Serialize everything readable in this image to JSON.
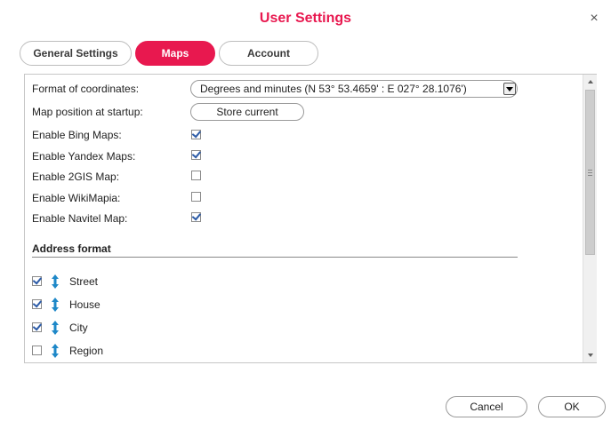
{
  "dialog": {
    "title": "User Settings",
    "close_symbol": "×"
  },
  "tabs": [
    {
      "label": "General Settings",
      "active": false
    },
    {
      "label": "Maps",
      "active": true
    },
    {
      "label": "Account",
      "active": false
    }
  ],
  "maps": {
    "format_label": "Format of coordinates:",
    "format_value": "Degrees and minutes (N 53° 53.4659' : E 027° 28.1076')",
    "startup_label": "Map position at startup:",
    "store_button": "Store current",
    "options": [
      {
        "label": "Enable Bing Maps:",
        "checked": true
      },
      {
        "label": "Enable Yandex Maps:",
        "checked": true
      },
      {
        "label": "Enable 2GIS Map:",
        "checked": false
      },
      {
        "label": "Enable WikiMapia:",
        "checked": false
      },
      {
        "label": "Enable Navitel Map:",
        "checked": true
      }
    ],
    "address_title": "Address format",
    "address_items": [
      {
        "label": "Street",
        "checked": true
      },
      {
        "label": "House",
        "checked": true
      },
      {
        "label": "City",
        "checked": true
      },
      {
        "label": "Region",
        "checked": false
      }
    ]
  },
  "footer": {
    "cancel": "Cancel",
    "ok": "OK"
  },
  "colors": {
    "accent": "#e8184f",
    "check": "#2f5da8",
    "arrow": "#1e88c8"
  },
  "icons": {
    "close": "close-icon",
    "reorder": "updown-arrow-icon",
    "dropdown": "chevron-down-icon"
  }
}
